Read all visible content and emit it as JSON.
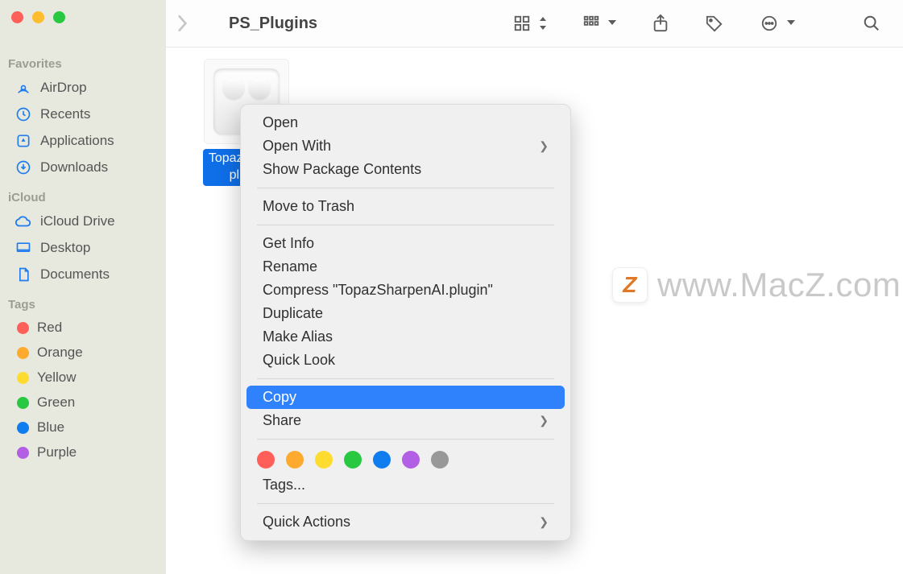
{
  "window": {
    "title": "PS_Plugins"
  },
  "sidebar": {
    "groups": [
      {
        "label": "Favorites",
        "items": [
          {
            "icon": "airdrop",
            "label": "AirDrop"
          },
          {
            "icon": "clock",
            "label": "Recents"
          },
          {
            "icon": "app",
            "label": "Applications"
          },
          {
            "icon": "download",
            "label": "Downloads"
          }
        ]
      },
      {
        "label": "iCloud",
        "items": [
          {
            "icon": "cloud",
            "label": "iCloud Drive"
          },
          {
            "icon": "desktop",
            "label": "Desktop"
          },
          {
            "icon": "doc",
            "label": "Documents"
          }
        ]
      },
      {
        "label": "Tags",
        "items": [
          {
            "color": "#fe5f58",
            "label": "Red"
          },
          {
            "color": "#feaa2f",
            "label": "Orange"
          },
          {
            "color": "#fedc2f",
            "label": "Yellow"
          },
          {
            "color": "#28c840",
            "label": "Green"
          },
          {
            "color": "#0f7cf0",
            "label": "Blue"
          },
          {
            "color": "#b25ee5",
            "label": "Purple"
          }
        ]
      }
    ]
  },
  "file": {
    "name_line1": "TopazSh...Al.",
    "name_line2": "plugin"
  },
  "context_menu": {
    "items": [
      {
        "label": "Open"
      },
      {
        "label": "Open With",
        "submenu": true
      },
      {
        "label": "Show Package Contents"
      },
      {
        "sep": true
      },
      {
        "label": "Move to Trash"
      },
      {
        "sep": true
      },
      {
        "label": "Get Info"
      },
      {
        "label": "Rename"
      },
      {
        "label": "Compress \"TopazSharpenAI.plugin\""
      },
      {
        "label": "Duplicate"
      },
      {
        "label": "Make Alias"
      },
      {
        "label": "Quick Look"
      },
      {
        "sep": true
      },
      {
        "label": "Copy",
        "selected": true
      },
      {
        "label": "Share",
        "submenu": true
      },
      {
        "sep": true
      },
      {
        "tagrow": true,
        "colors": [
          "#fe5f58",
          "#feaa2f",
          "#fedc2f",
          "#28c840",
          "#0f7cf0",
          "#b25ee5",
          "#989898"
        ]
      },
      {
        "label": "Tags..."
      },
      {
        "sep": true
      },
      {
        "label": "Quick Actions",
        "submenu": true
      }
    ]
  },
  "watermark": {
    "badge": "Z",
    "text": "www.MacZ.com"
  }
}
